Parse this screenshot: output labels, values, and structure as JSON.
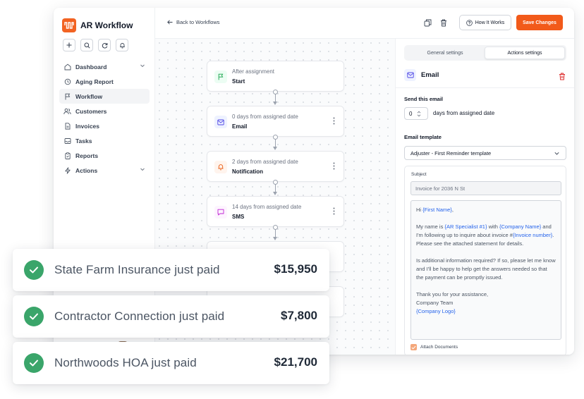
{
  "brand": {
    "name": "AR Workflow",
    "color": "#f26322"
  },
  "quick_actions": [
    "plus-icon",
    "search-icon",
    "refresh-icon",
    "bell-icon"
  ],
  "sidebar": {
    "items": [
      {
        "label": "Dashboard",
        "icon": "home-icon",
        "has_chevron": true
      },
      {
        "label": "Aging Report",
        "icon": "clock-icon"
      },
      {
        "label": "Workflow",
        "icon": "flag-icon",
        "active": true
      },
      {
        "label": "Customers",
        "icon": "users-icon"
      },
      {
        "label": "Invoices",
        "icon": "file-icon"
      },
      {
        "label": "Tasks",
        "icon": "inbox-icon"
      },
      {
        "label": "Reports",
        "icon": "clipboard-icon"
      },
      {
        "label": "Actions",
        "icon": "zap-icon",
        "has_chevron": true
      }
    ]
  },
  "topbar": {
    "back_label": "Back to Workflows",
    "how_label": "How It Works",
    "save_label": "Save Changes",
    "accent": "#f25a1a"
  },
  "workflow": {
    "nodes": [
      {
        "sub": "After assignment",
        "title": "Start",
        "icon": "flag-icon",
        "color": "#16a34a",
        "bg": "#ecfdf3"
      },
      {
        "sub": "0 days from assigned date",
        "title": "Email",
        "icon": "mail-icon",
        "color": "#4f46e5",
        "bg": "#eef2ff"
      },
      {
        "sub": "2 days from assigned date",
        "title": "Notification",
        "icon": "bell-icon",
        "color": "#ea580c",
        "bg": "#fff4ed"
      },
      {
        "sub": "14 days from assigned date",
        "title": "SMS",
        "icon": "message-icon",
        "color": "#c026d3",
        "bg": "#fdf4ff"
      }
    ]
  },
  "panel": {
    "tabs": [
      "General settings",
      "Actions settings"
    ],
    "active_tab": 1,
    "header": "Email",
    "send_label": "Send this email",
    "days_value": "0",
    "days_text": "days from assigned date",
    "template_label": "Email template",
    "template_value": "Adjuster - First Reminder template",
    "subject_label": "Subject",
    "subject_value": "Invoice for 2036 N St",
    "body": {
      "greeting": "Hi ",
      "first_name": "{First Name}",
      "greeting_end": ",",
      "p2_a": "My name is ",
      "ar_specialist": "{AR Specialist #1}",
      "p2_b": " with ",
      "company_name": "{Company Name}",
      "p2_c": " and I'm following up to inquire about invoice #",
      "invoice_number": "{Invoice number}",
      "p2_d": ". Please see the attached statement for details.",
      "p3": "Is additional information required? If so, please let me know and I'll be happy to help get the answers needed so that the payment can be promptly issued.",
      "p4_a": "Thank you for your assistance,",
      "p4_b": "Company Team",
      "company_logo": "{Company Logo}"
    },
    "attach_label": "Attach Documents"
  },
  "notifications": [
    {
      "text": "State Farm Insurance just paid",
      "amount": "$15,950"
    },
    {
      "text": "Contractor Connection just paid",
      "amount": "$7,800"
    },
    {
      "text": "Northwoods HOA just paid",
      "amount": "$21,700"
    }
  ],
  "colors": {
    "success": "#3aa56a",
    "link": "#2563eb"
  }
}
